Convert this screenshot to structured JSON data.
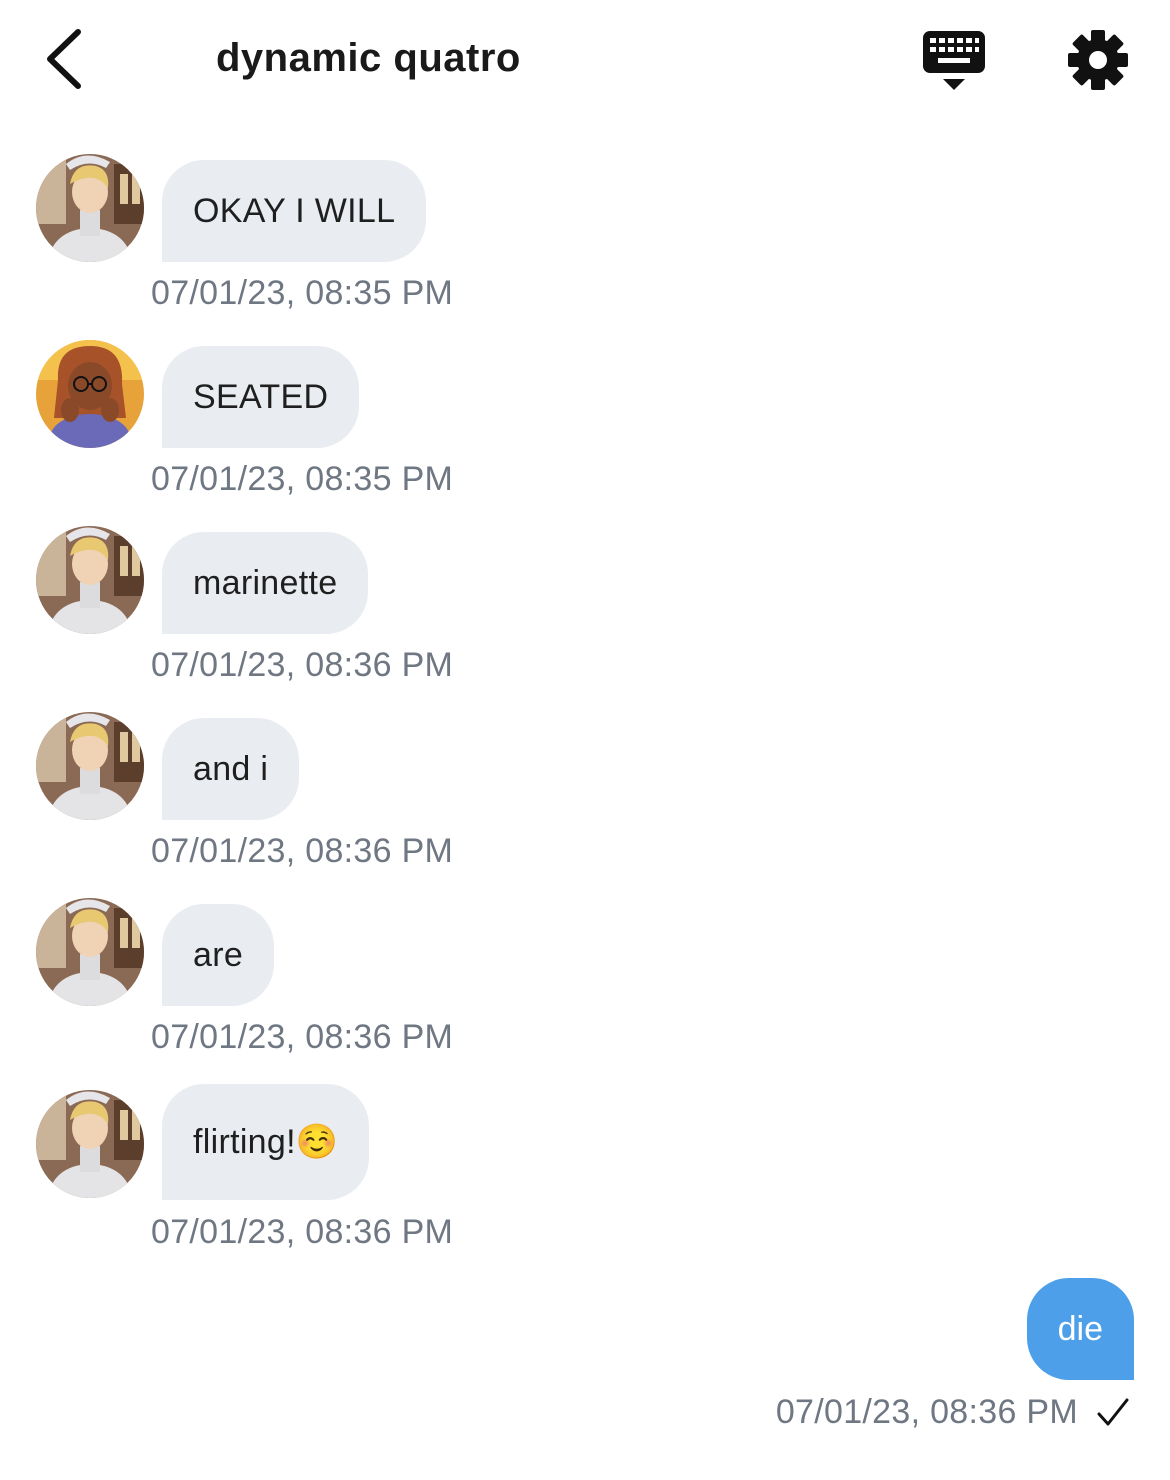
{
  "header": {
    "title": "dynamic quatro",
    "back_icon": "chevron-left-icon",
    "keyboard_icon": "keyboard-icon",
    "settings_icon": "gear-icon"
  },
  "messages": [
    {
      "text": "OKAY I WILL",
      "time": "07/01/23, 08:35 PM",
      "avatar": "blonde-boy"
    },
    {
      "text": "SEATED",
      "time": "07/01/23, 08:35 PM",
      "avatar": "girl-glasses"
    },
    {
      "text": "marinette",
      "time": "07/01/23, 08:36 PM",
      "avatar": "blonde-boy"
    },
    {
      "text": "and i",
      "time": "07/01/23, 08:36 PM",
      "avatar": "blonde-boy"
    },
    {
      "text": "are",
      "time": "07/01/23, 08:36 PM",
      "avatar": "blonde-boy"
    },
    {
      "text": "flirting!☺️",
      "time": "07/01/23, 08:36 PM",
      "avatar": "blonde-boy"
    }
  ],
  "outgoing": {
    "text": "die",
    "time": "07/01/23, 08:36 PM",
    "status_icon": "checkmark-icon"
  },
  "colors": {
    "incoming_bubble": "#e9ecf1",
    "outgoing_bubble": "#4c9fe8",
    "timestamp": "#6f7783",
    "title": "#1a1a1a"
  }
}
